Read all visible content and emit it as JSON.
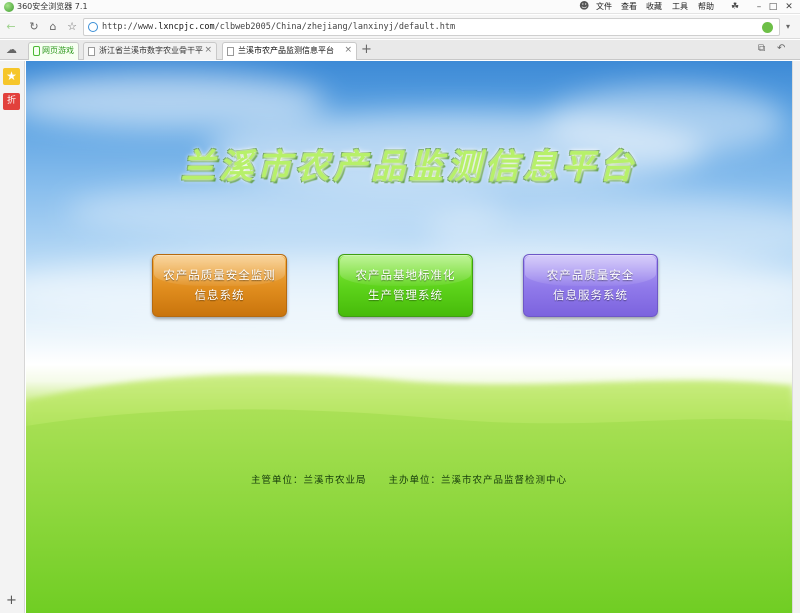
{
  "window": {
    "title": "360安全浏览器 7.1",
    "menu": [
      "文件",
      "查看",
      "收藏",
      "工具",
      "帮助"
    ]
  },
  "address_bar": {
    "url_prefix": "http://www.",
    "url_host": "lxncpjc.com",
    "url_path": "/clbweb2005/China/zhejiang/lanxinyj/default.htm"
  },
  "tabs": [
    {
      "label": "网页游戏"
    },
    {
      "label": "浙江省兰溪市数字农业骨干平台"
    },
    {
      "label": "兰溪市农产品监测信息平台"
    }
  ],
  "page": {
    "title": "兰溪市农产品监测信息平台",
    "buttons": [
      {
        "line1": "农产品质量安全监测",
        "line2": "信息系统"
      },
      {
        "line1": "农产品基地标准化",
        "line2": "生产管理系统"
      },
      {
        "line1": "农产品质量安全",
        "line2": "信息服务系统"
      }
    ],
    "footer": {
      "supervisor": "主管单位：兰溪市农业局",
      "organizer": "主办单位：兰溪市农产品监督检测中心"
    }
  },
  "colors": {
    "sky_top": "#3d8ad6",
    "grass": "#5cc511",
    "button_orange": "#e08d1e",
    "button_green": "#5cd21a",
    "button_purple": "#8f79ea",
    "title_green": "#b7f06a"
  },
  "icons": [
    "app-logo-icon",
    "user-icon",
    "back-icon",
    "refresh-icon",
    "home-icon",
    "star-icon",
    "globe-icon",
    "cloud-icon",
    "favorites-icon",
    "deal-icon",
    "add-icon"
  ]
}
